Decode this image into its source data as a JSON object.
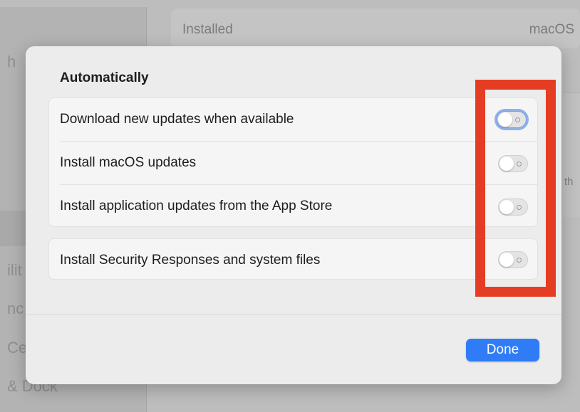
{
  "background": {
    "installed_label": "Installed",
    "installed_value": "macOS",
    "sidebar_fragments": [
      "h",
      "ilit",
      "nc",
      "Ce",
      "& Dock"
    ],
    "right_fragment": "th"
  },
  "sheet": {
    "section_title": "Automatically",
    "groups": [
      {
        "rows": [
          {
            "label": "Download new updates when available",
            "enabled": false,
            "focused": true
          },
          {
            "label": "Install macOS updates",
            "enabled": false
          },
          {
            "label": "Install application updates from the App Store",
            "enabled": false
          }
        ]
      },
      {
        "rows": [
          {
            "label": "Install Security Responses and system files",
            "enabled": false
          }
        ]
      }
    ],
    "done_label": "Done"
  },
  "colors": {
    "accent": "#2f7cf6",
    "highlight": "#e53d24"
  }
}
